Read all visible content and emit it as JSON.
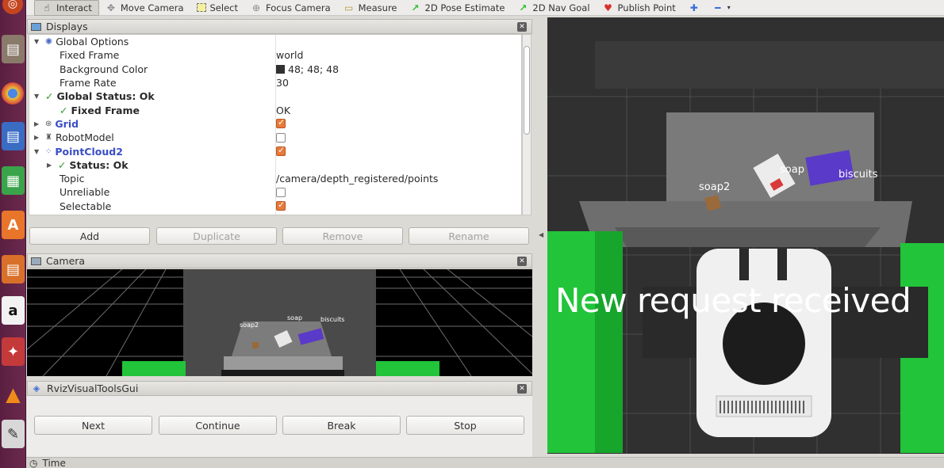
{
  "toolbar": {
    "tools": [
      {
        "label": "Interact",
        "icon": "pointer-icon"
      },
      {
        "label": "Move Camera",
        "icon": "move-camera-icon"
      },
      {
        "label": "Select",
        "icon": "select-icon"
      },
      {
        "label": "Focus Camera",
        "icon": "focus-camera-icon"
      },
      {
        "label": "Measure",
        "icon": "ruler-icon"
      },
      {
        "label": "2D Pose Estimate",
        "icon": "green-arrow-icon"
      },
      {
        "label": "2D Nav Goal",
        "icon": "green-arrow-icon"
      },
      {
        "label": "Publish Point",
        "icon": "red-pin-icon"
      }
    ]
  },
  "displays": {
    "title": "Displays",
    "rows": [
      {
        "label": "Global Options",
        "value": ""
      },
      {
        "label": "Fixed Frame",
        "value": "world"
      },
      {
        "label": "Background Color",
        "value": "48; 48; 48"
      },
      {
        "label": "Frame Rate",
        "value": "30"
      },
      {
        "label": "Global Status: Ok",
        "value": ""
      },
      {
        "label": "Fixed Frame",
        "value": "OK"
      },
      {
        "label": "Grid",
        "value": ""
      },
      {
        "label": "RobotModel",
        "value": ""
      },
      {
        "label": "PointCloud2",
        "value": ""
      },
      {
        "label": "Status: Ok",
        "value": ""
      },
      {
        "label": "Topic",
        "value": "/camera/depth_registered/points"
      },
      {
        "label": "Unreliable",
        "value": ""
      },
      {
        "label": "Selectable",
        "value": ""
      }
    ],
    "buttons": {
      "add": "Add",
      "duplicate": "Duplicate",
      "remove": "Remove",
      "rename": "Rename"
    }
  },
  "camera": {
    "title": "Camera",
    "labels": {
      "soap2": "soap2",
      "soap": "soap",
      "biscuits": "biscuits"
    }
  },
  "rviz_gui": {
    "title": "RvizVisualToolsGui",
    "buttons": {
      "next": "Next",
      "continue": "Continue",
      "break": "Break",
      "stop": "Stop"
    }
  },
  "viewport": {
    "labels": {
      "soap2": "soap2",
      "soap": "soap",
      "biscuits": "biscuits"
    },
    "message": "New request received"
  },
  "time": {
    "title": "Time"
  },
  "colors": {
    "background": "#303030",
    "accent_orange": "#e87a3a",
    "green_table": "#22c43a",
    "status_green": "#2f9a2f"
  }
}
